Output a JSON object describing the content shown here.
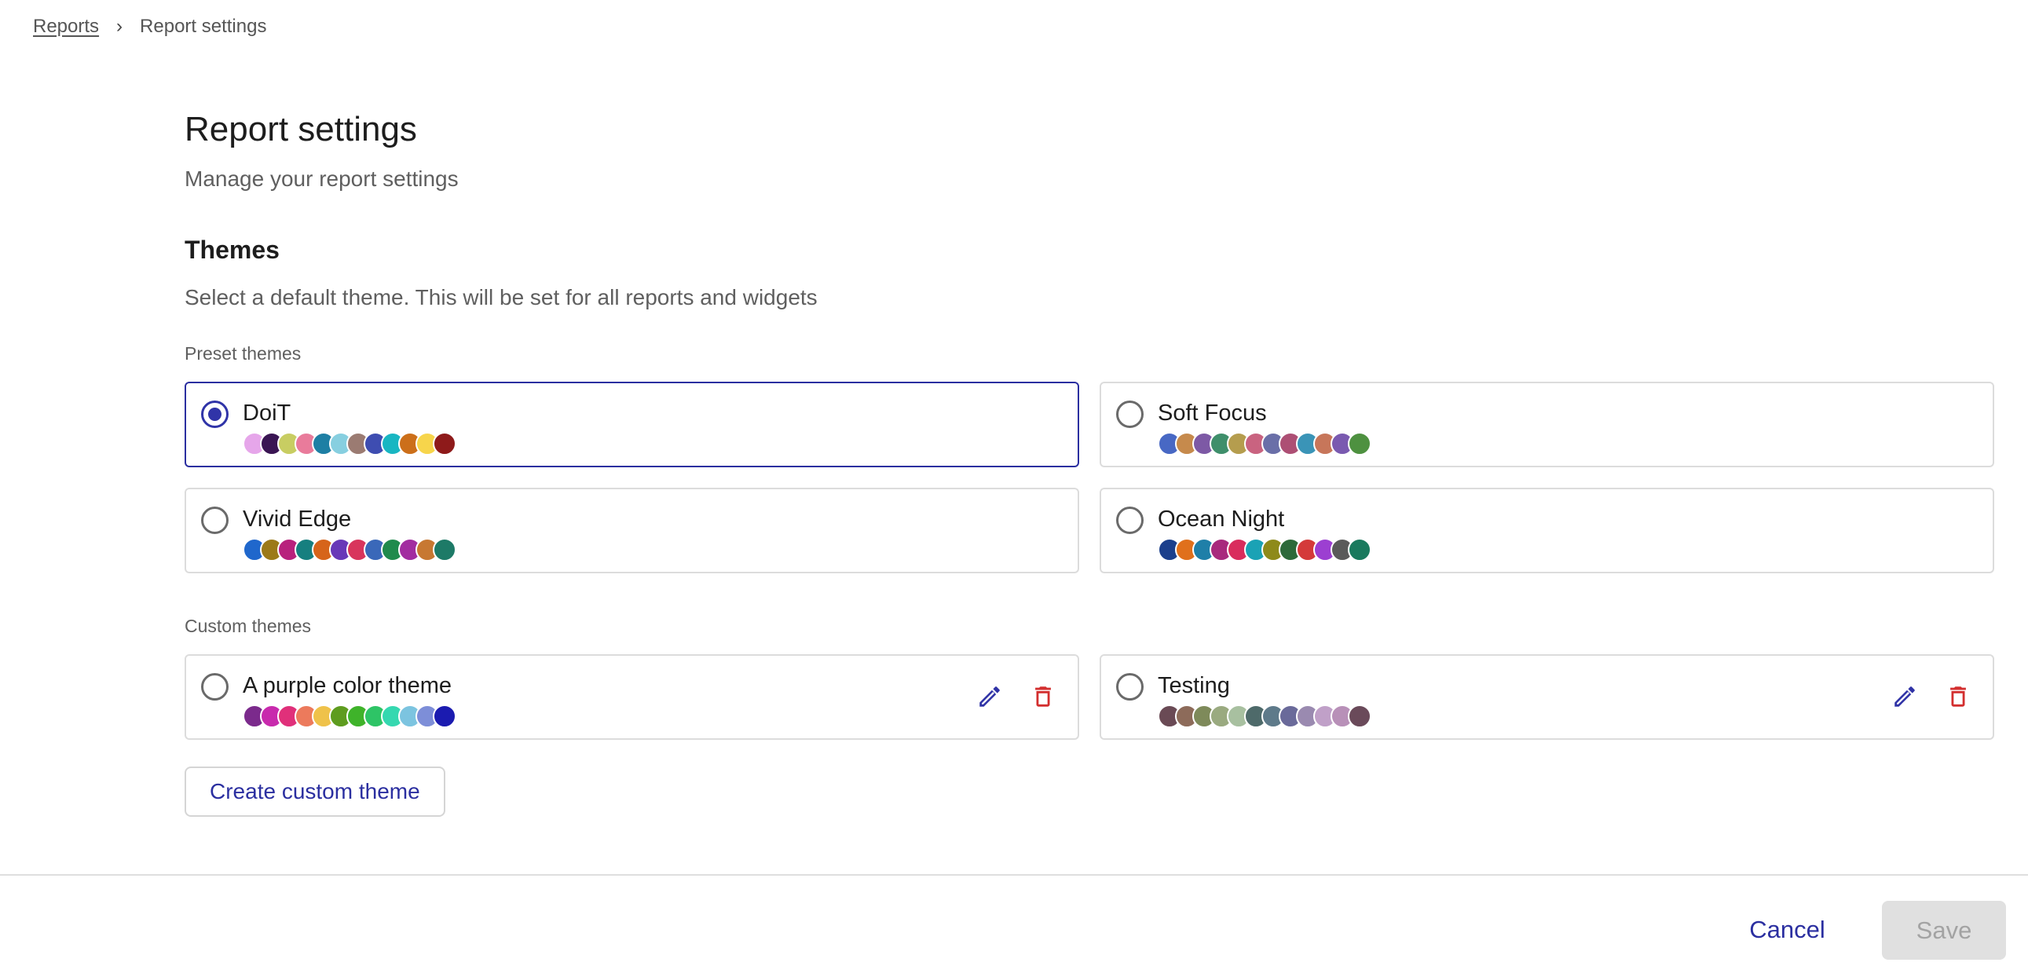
{
  "breadcrumb": {
    "parent": "Reports",
    "separator": "›",
    "current": "Report settings"
  },
  "page": {
    "title": "Report settings",
    "subtitle": "Manage your report settings"
  },
  "themes": {
    "title": "Themes",
    "description": "Select a default theme. This will be set for all reports and widgets",
    "preset_label": "Preset themes",
    "custom_label": "Custom themes",
    "create_button": "Create custom theme",
    "preset": [
      {
        "name": "DoiT",
        "selected": true,
        "colors": [
          "#e6a6ea",
          "#3a1553",
          "#c8cd62",
          "#e97b9b",
          "#1e7fa4",
          "#87cfe0",
          "#9b7b72",
          "#3e4db1",
          "#18b6c2",
          "#cc6f1a",
          "#f7d54b",
          "#8e1a1a"
        ]
      },
      {
        "name": "Soft Focus",
        "selected": false,
        "colors": [
          "#4868c4",
          "#c68a4c",
          "#7d59a5",
          "#3f8f6b",
          "#b59d4e",
          "#c96380",
          "#6a6fa8",
          "#ad4f74",
          "#3a94b7",
          "#c7765a",
          "#7a5ab0",
          "#4e9140"
        ]
      },
      {
        "name": "Vivid Edge",
        "selected": false,
        "colors": [
          "#1f67cc",
          "#9c7a18",
          "#b8217d",
          "#167f7f",
          "#d6641a",
          "#6938b8",
          "#d8355c",
          "#3a68b9",
          "#1f8a4c",
          "#a22da0",
          "#c77832",
          "#1d7a67"
        ]
      },
      {
        "name": "Ocean Night",
        "selected": false,
        "colors": [
          "#1b3f8c",
          "#e0701c",
          "#1f7fa8",
          "#a8297d",
          "#d92d5d",
          "#1aa2b5",
          "#8e8a1a",
          "#2e6a3a",
          "#d43a3a",
          "#9c3fd1",
          "#5a5a5a",
          "#1a7a5e"
        ]
      }
    ],
    "custom": [
      {
        "name": "A purple color theme",
        "selected": false,
        "colors": [
          "#7b2a8c",
          "#c82aad",
          "#e0307a",
          "#ec7a5c",
          "#efc24a",
          "#5e9c1f",
          "#3fb32a",
          "#2ec466",
          "#35d8b0",
          "#7cc4e0",
          "#7d8ed8",
          "#1b1bb0"
        ]
      },
      {
        "name": "Testing",
        "selected": false,
        "colors": [
          "#6a4a55",
          "#8d6b5a",
          "#7e8a5a",
          "#9aaa80",
          "#a8c0a0",
          "#4e6a6a",
          "#5e7a8a",
          "#6a6a9a",
          "#9a8ab0",
          "#c0a0c8",
          "#b890b8",
          "#6a4a5a"
        ]
      }
    ]
  },
  "footer": {
    "cancel": "Cancel",
    "save": "Save"
  }
}
